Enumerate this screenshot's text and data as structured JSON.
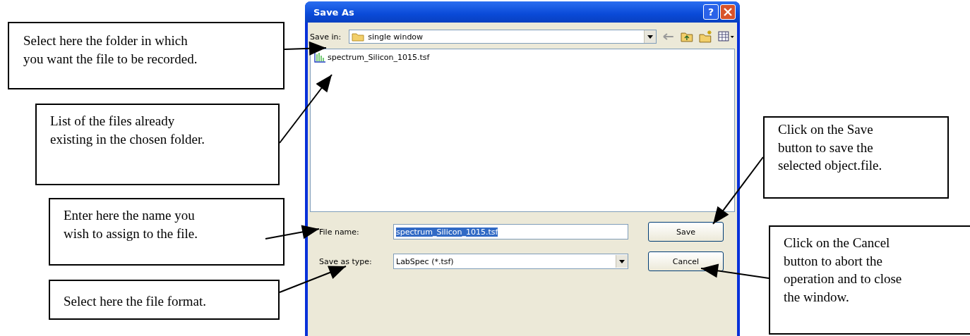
{
  "dialog": {
    "title": "Save As",
    "help_button": "?",
    "save_in_label": "Save in:",
    "folder": "single window",
    "files": [
      {
        "name": "spectrum_Silicon_1015.tsf"
      }
    ],
    "file_name": {
      "label": "File name:",
      "value": "spectrum_Silicon_1015.tsf",
      "selected": true
    },
    "save_as_type": {
      "label": "Save as type:",
      "value": "LabSpec (*.tsf)"
    },
    "buttons": [
      "Save",
      "Cancel"
    ]
  },
  "callouts": [
    {
      "text": "Select here the folder in which\nyou want the file to be recorded."
    },
    {
      "text": "List of the files already\nexisting in the chosen folder."
    },
    {
      "text": "Enter here the name you\nwish to assign to the file."
    },
    {
      "text": "Select here the file format."
    },
    {
      "text": "Click on the Save\nbutton to save the\nselected object.file."
    },
    {
      "text": "Click on the Cancel\nbutton to abort the\noperation and to close\nthe window."
    }
  ]
}
